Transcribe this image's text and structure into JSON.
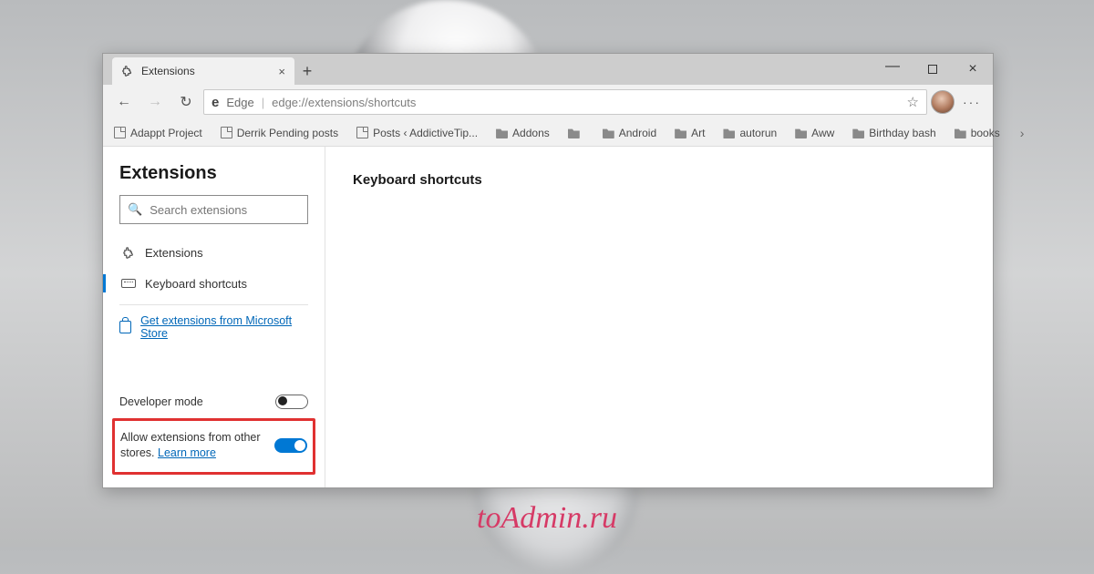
{
  "watermark": "toAdmin.ru",
  "window": {
    "tab_title": "Extensions",
    "address": {
      "scheme_label": "Edge",
      "url": "edge://extensions/shortcuts"
    }
  },
  "bookmarks": [
    {
      "type": "page",
      "label": "Adappt Project"
    },
    {
      "type": "page",
      "label": "Derrik Pending posts"
    },
    {
      "type": "page",
      "label": "Posts ‹ AddictiveTip..."
    },
    {
      "type": "folder",
      "label": "Addons"
    },
    {
      "type": "folder",
      "label": ""
    },
    {
      "type": "folder",
      "label": "Android"
    },
    {
      "type": "folder",
      "label": "Art"
    },
    {
      "type": "folder",
      "label": "autorun"
    },
    {
      "type": "folder",
      "label": "Aww"
    },
    {
      "type": "folder",
      "label": "Birthday bash"
    },
    {
      "type": "folder",
      "label": "books"
    }
  ],
  "sidebar": {
    "title": "Extensions",
    "search_placeholder": "Search extensions",
    "nav": {
      "extensions": "Extensions",
      "shortcuts": "Keyboard shortcuts"
    },
    "store_link": "Get extensions from Microsoft Store",
    "dev_mode_label": "Developer mode",
    "dev_mode_on": false,
    "allow_other_label": "Allow extensions from other stores.",
    "learn_more": "Learn more",
    "allow_other_on": true
  },
  "main": {
    "heading": "Keyboard shortcuts"
  }
}
